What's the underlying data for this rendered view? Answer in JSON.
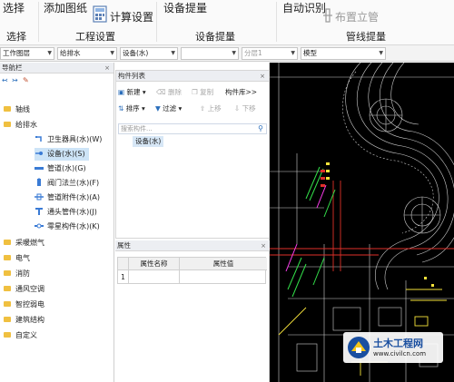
{
  "ribbon": {
    "select_label": "选择",
    "add_drawing_label": "添加图纸",
    "calc_settings_label": "计算设置",
    "device_extract_label": "设备提量",
    "auto_identify_label": "自动识别",
    "place_riser_label": "布置立管",
    "groups": {
      "select": "选择",
      "project_settings": "工程设置",
      "device_extract": "设备提量",
      "pipeline_extract": "管线提量"
    },
    "accent_color": "#2a6ebb"
  },
  "toolbar": {
    "layer_combo": "工作图层",
    "major_combo": "给排水",
    "device_combo": "设备(水)",
    "empty_combo": "",
    "floor_combo": "分层1",
    "model_combo": "模型"
  },
  "nav": {
    "title": "导航栏",
    "items": [
      {
        "label": "轴线"
      },
      {
        "label": "给排水"
      },
      {
        "label": "卫生器具(水)(W)"
      },
      {
        "label": "设备(水)(S)"
      },
      {
        "label": "管道(水)(G)"
      },
      {
        "label": "阀门法兰(水)(F)"
      },
      {
        "label": "管道附件(水)(A)"
      },
      {
        "label": "通头管件(水)(J)"
      },
      {
        "label": "零星构件(水)(K)"
      },
      {
        "label": "采暖燃气"
      },
      {
        "label": "电气"
      },
      {
        "label": "消防"
      },
      {
        "label": "通风空调"
      },
      {
        "label": "智控弱电"
      },
      {
        "label": "建筑结构"
      },
      {
        "label": "自定义"
      }
    ]
  },
  "component_list": {
    "title": "构件列表",
    "new_label": "新建",
    "delete_label": "删除",
    "copy_label": "复制",
    "library_label": "构件库>>",
    "sort_label": "排序",
    "filter_label": "过滤",
    "move_up_label": "上移",
    "move_down_label": "下移",
    "search_placeholder": "搜索构件...",
    "items": [
      {
        "label": "设备(水)"
      }
    ]
  },
  "properties": {
    "title": "属性",
    "col_name": "属性名称",
    "col_value": "属性值",
    "rows": [
      {
        "index": "1",
        "name": "",
        "value": ""
      }
    ]
  },
  "watermark": {
    "title": "土木工程网",
    "url": "www.civilcn.com"
  }
}
